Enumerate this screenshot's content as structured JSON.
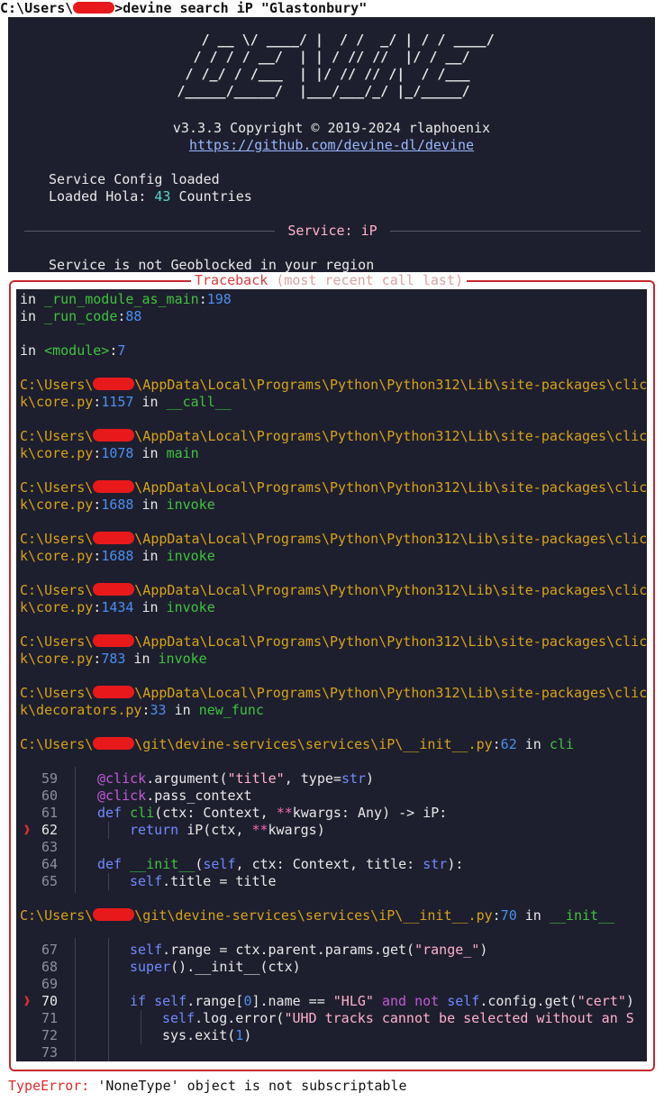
{
  "cmdline": {
    "prefix": "C:\\Users\\",
    "suffix": ">devine search iP \"Glastonbury\""
  },
  "header": {
    "banner": "    / __ \\/ ____/ |  / /  _/ | / / ____/\n   / / / / __/  | | / // //  |/ / __/   \n  / /_/ / /___  | |/ // // /|  / /___   \n /_____/_____/  |___/___/_/ |_/_____/   ",
    "version": "v3.3.3 Copyright © 2019-2024 rlaphoenix",
    "repo": "https://github.com/devine-dl/devine",
    "config_loaded": "Service Config loaded",
    "hola_prefix": "Loaded Hola: ",
    "hola_count": "43",
    "hola_suffix": " Countries",
    "service_label": "Service: iP",
    "geo_status": "Service is not Geoblocked in your region"
  },
  "traceback": {
    "title": "Traceback",
    "subtitle": "(most recent call last)",
    "frame1_fn": "_run_module_as_main",
    "frame1_ln": "198",
    "frame2_fn": "_run_code",
    "frame2_ln": "88",
    "frame3_fn": "<module>",
    "frame3_ln": "7",
    "path_prefix": "C:\\Users\\",
    "path_lib": "\\AppData\\Local\\Programs\\Python\\Python312\\Lib\\site-packages\\clic",
    "core_file": "k\\core.py",
    "deco_file": "k\\decorators.py",
    "frames": [
      {
        "ln": "1157",
        "fn": "__call__"
      },
      {
        "ln": "1078",
        "fn": "main"
      },
      {
        "ln": "1688",
        "fn": "invoke"
      },
      {
        "ln": "1688",
        "fn": "invoke"
      },
      {
        "ln": "1434",
        "fn": "invoke"
      },
      {
        "ln": "783",
        "fn": "invoke"
      }
    ],
    "deco_ln": "33",
    "deco_fn": "new_func",
    "git_path": "\\git\\devine-services\\services\\iP\\__init__.py",
    "git1_ln": "62",
    "git1_fn": "cli",
    "git2_ln": "70",
    "git2_fn": "__init__",
    "in_word": " in "
  },
  "error": {
    "type": "TypeError:",
    "message": " 'NoneType' object is not subscriptable"
  }
}
